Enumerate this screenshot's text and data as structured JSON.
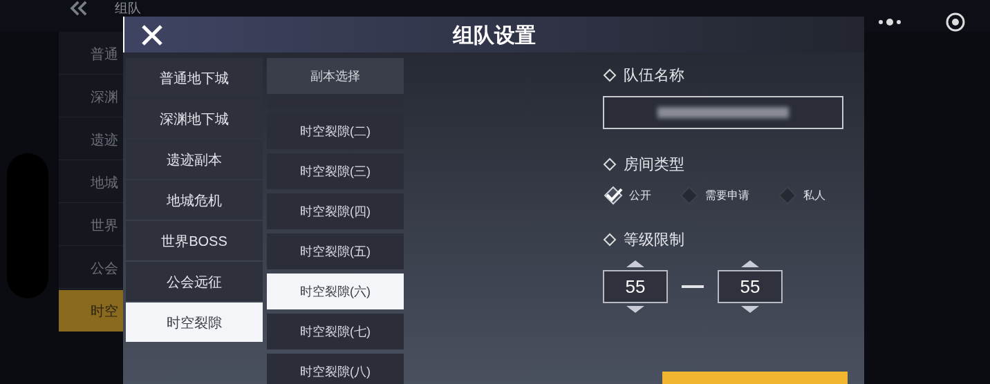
{
  "background": {
    "title": "组队",
    "menu": [
      {
        "label": "普通",
        "selected": false
      },
      {
        "label": "深渊",
        "selected": false
      },
      {
        "label": "遗迹",
        "selected": false
      },
      {
        "label": "地城",
        "selected": false
      },
      {
        "label": "世界",
        "selected": false
      },
      {
        "label": "公会",
        "selected": false
      },
      {
        "label": "时空",
        "selected": true
      }
    ]
  },
  "dialog": {
    "title": "组队设置",
    "categories": [
      {
        "label": "普通地下城",
        "selected": false
      },
      {
        "label": "深渊地下城",
        "selected": false
      },
      {
        "label": "遗迹副本",
        "selected": false
      },
      {
        "label": "地城危机",
        "selected": false
      },
      {
        "label": "世界BOSS",
        "selected": false
      },
      {
        "label": "公会远征",
        "selected": false
      },
      {
        "label": "时空裂隙",
        "selected": true
      }
    ],
    "instance_header": "副本选择",
    "instances": [
      {
        "label": "时空裂隙(二)",
        "selected": false
      },
      {
        "label": "时空裂隙(三)",
        "selected": false
      },
      {
        "label": "时空裂隙(四)",
        "selected": false
      },
      {
        "label": "时空裂隙(五)",
        "selected": false
      },
      {
        "label": "时空裂隙(六)",
        "selected": true
      },
      {
        "label": "时空裂隙(七)",
        "selected": false
      },
      {
        "label": "时空裂隙(八)",
        "selected": false
      }
    ],
    "team_name": {
      "label": "队伍名称"
    },
    "room_type": {
      "label": "房间类型",
      "options": [
        {
          "label": "公开",
          "selected": true
        },
        {
          "label": "需要申请",
          "selected": false
        },
        {
          "label": "私人",
          "selected": false
        }
      ]
    },
    "level_limit": {
      "label": "等级限制",
      "min": "55",
      "max": "55"
    }
  }
}
